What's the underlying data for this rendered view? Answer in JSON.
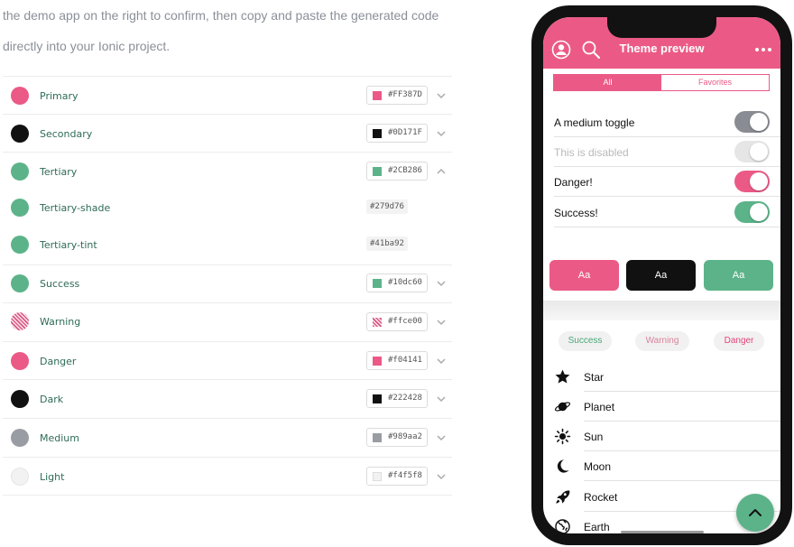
{
  "intro": {
    "line1": "the demo app on the right to confirm, then copy and paste the generated code",
    "line2": "directly into your Ionic project."
  },
  "colors": [
    {
      "name": "Primary",
      "hex": "#FF387D",
      "swatch": "#eb5a86",
      "expanded": false
    },
    {
      "name": "Secondary",
      "hex": "#0D171F",
      "swatch": "#111111",
      "expanded": false
    },
    {
      "name": "Tertiary",
      "hex": "#2CB286",
      "swatch": "#5cb389",
      "expanded": true
    },
    {
      "name": "Tertiary-shade",
      "hex": "#279d76",
      "swatch": "#5cb389",
      "sub": true
    },
    {
      "name": "Tertiary-tint",
      "hex": "#41ba92",
      "swatch": "#5cb389",
      "sub": true
    },
    {
      "name": "Success",
      "hex": "#10dc60",
      "swatch": "#5cb389",
      "expanded": false
    },
    {
      "name": "Warning",
      "hex": "#ffce00",
      "swatch": "#e0658f",
      "pattern": "hatched",
      "expanded": false
    },
    {
      "name": "Danger",
      "hex": "#f04141",
      "swatch": "#eb5a86",
      "expanded": false
    },
    {
      "name": "Dark",
      "hex": "#222428",
      "swatch": "#111111",
      "expanded": false
    },
    {
      "name": "Medium",
      "hex": "#989aa2",
      "swatch": "#9a9ca3",
      "expanded": false
    },
    {
      "name": "Light",
      "hex": "#f4f5f8",
      "swatch": "#f2f2f2",
      "expanded": false
    }
  ],
  "phone": {
    "title": "Theme preview",
    "accent": "#eb5a86",
    "success": "#5cb389",
    "dark": "#111111",
    "segment": [
      "All",
      "Favorites"
    ],
    "toggles": [
      {
        "label": "A medium toggle",
        "on": true,
        "color": "#8a8c93",
        "disabled": false
      },
      {
        "label": "This is disabled",
        "on": true,
        "color": "#e6e6e6",
        "disabled": true
      },
      {
        "label": "Danger!",
        "on": true,
        "color": "#eb5a86",
        "disabled": false
      },
      {
        "label": "Success!",
        "on": true,
        "color": "#5cb389",
        "disabled": false
      }
    ],
    "buttons": [
      "Aa",
      "Aa",
      "Aa"
    ],
    "chips": [
      {
        "label": "Success",
        "color": "#4aa678"
      },
      {
        "label": "Warning",
        "color": "#d9829c"
      },
      {
        "label": "Danger",
        "color": "#e0457a"
      }
    ],
    "list": [
      {
        "label": "Star",
        "icon": "star-icon"
      },
      {
        "label": "Planet",
        "icon": "planet-icon"
      },
      {
        "label": "Sun",
        "icon": "sun-icon"
      },
      {
        "label": "Moon",
        "icon": "moon-icon"
      },
      {
        "label": "Rocket",
        "icon": "rocket-icon"
      },
      {
        "label": "Earth",
        "icon": "earth-icon"
      }
    ]
  }
}
